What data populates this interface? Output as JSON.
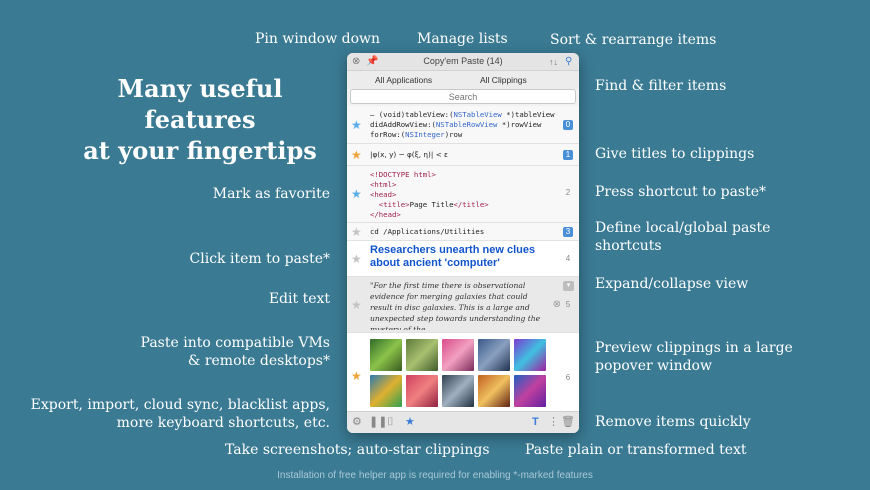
{
  "headline": [
    "Many useful features",
    "at your fingertips"
  ],
  "callouts": {
    "pin_window": "Pin window down",
    "manage_lists": "Manage lists",
    "sort_items": "Sort & rearrange items",
    "find_filter": "Find & filter items",
    "give_titles": "Give titles to clippings",
    "press_shortcut": "Press shortcut to paste*",
    "define_shortcuts_1": "Define local/global paste",
    "define_shortcuts_2": "shortcuts",
    "expand_collapse": "Expand/collapse view",
    "preview_1": "Preview clippings in a large",
    "preview_2": "popover window",
    "remove_items": "Remove items quickly",
    "paste_plain": "Paste plain or transformed text",
    "mark_favorite": "Mark as favorite",
    "click_item": "Click item to paste*",
    "edit_text": "Edit text",
    "paste_vms_1": "Paste into compatible VMs",
    "paste_vms_2": "& remote desktops*",
    "export_1": "Export, import, cloud sync, blacklist apps,",
    "export_2": "more keyboard shortcuts, etc.",
    "screenshots": "Take screenshots; auto-star clippings"
  },
  "footnote": "Installation of free helper app is required for enabling *-marked features",
  "window": {
    "title": "Copy'em Paste (14)",
    "filter_apps": "All Applications",
    "filter_clippings": "All Clippings",
    "search_placeholder": "Search",
    "rows": [
      {
        "num": "0",
        "starred": false
      },
      {
        "text": "|φ(x, y) − φ(ξ, η)| < ε",
        "num": "1",
        "starred": true
      },
      {
        "num": "2",
        "starred": false
      },
      {
        "text": "cd /Applications/Utilities",
        "num": "3",
        "starred": false
      },
      {
        "text": "Researchers unearth new clues about ancient 'computer'",
        "num": "4",
        "starred": false
      },
      {
        "text": "\"For the first time there is observational evidence for merging galaxies that could result in disc galaxies. This is a large and unexpected step towards understanding the mystery of the…",
        "num": "5",
        "starred": false
      },
      {
        "num": "6",
        "starred": true
      }
    ],
    "code_row0": [
      "– (void)tableView:(",
      "NSTableView",
      " *)tableView",
      "didAddRowView:(",
      "NSTableRowView",
      " *)rowView",
      "forRow:(",
      "NSInteger",
      ")row"
    ],
    "html_row2": [
      "<!DOCTYPE html>",
      "<html>",
      "<head>",
      "<title>",
      "Page Title",
      "</title>",
      "</head>"
    ]
  },
  "colors": {
    "background": "#3a7a93",
    "star_blue": "#5aaee8",
    "star_orange": "#f0a43c",
    "badge_blue": "#4a90d9",
    "link_blue": "#1155cc"
  },
  "icons": [
    "close-icon",
    "pin-icon",
    "sort-icon",
    "search-icon",
    "star-icon",
    "gear-icon",
    "pause-icon",
    "camera-icon",
    "star-filter-icon",
    "text-transform-icon",
    "more-icon",
    "trash-icon",
    "expand-icon",
    "remove-icon"
  ]
}
